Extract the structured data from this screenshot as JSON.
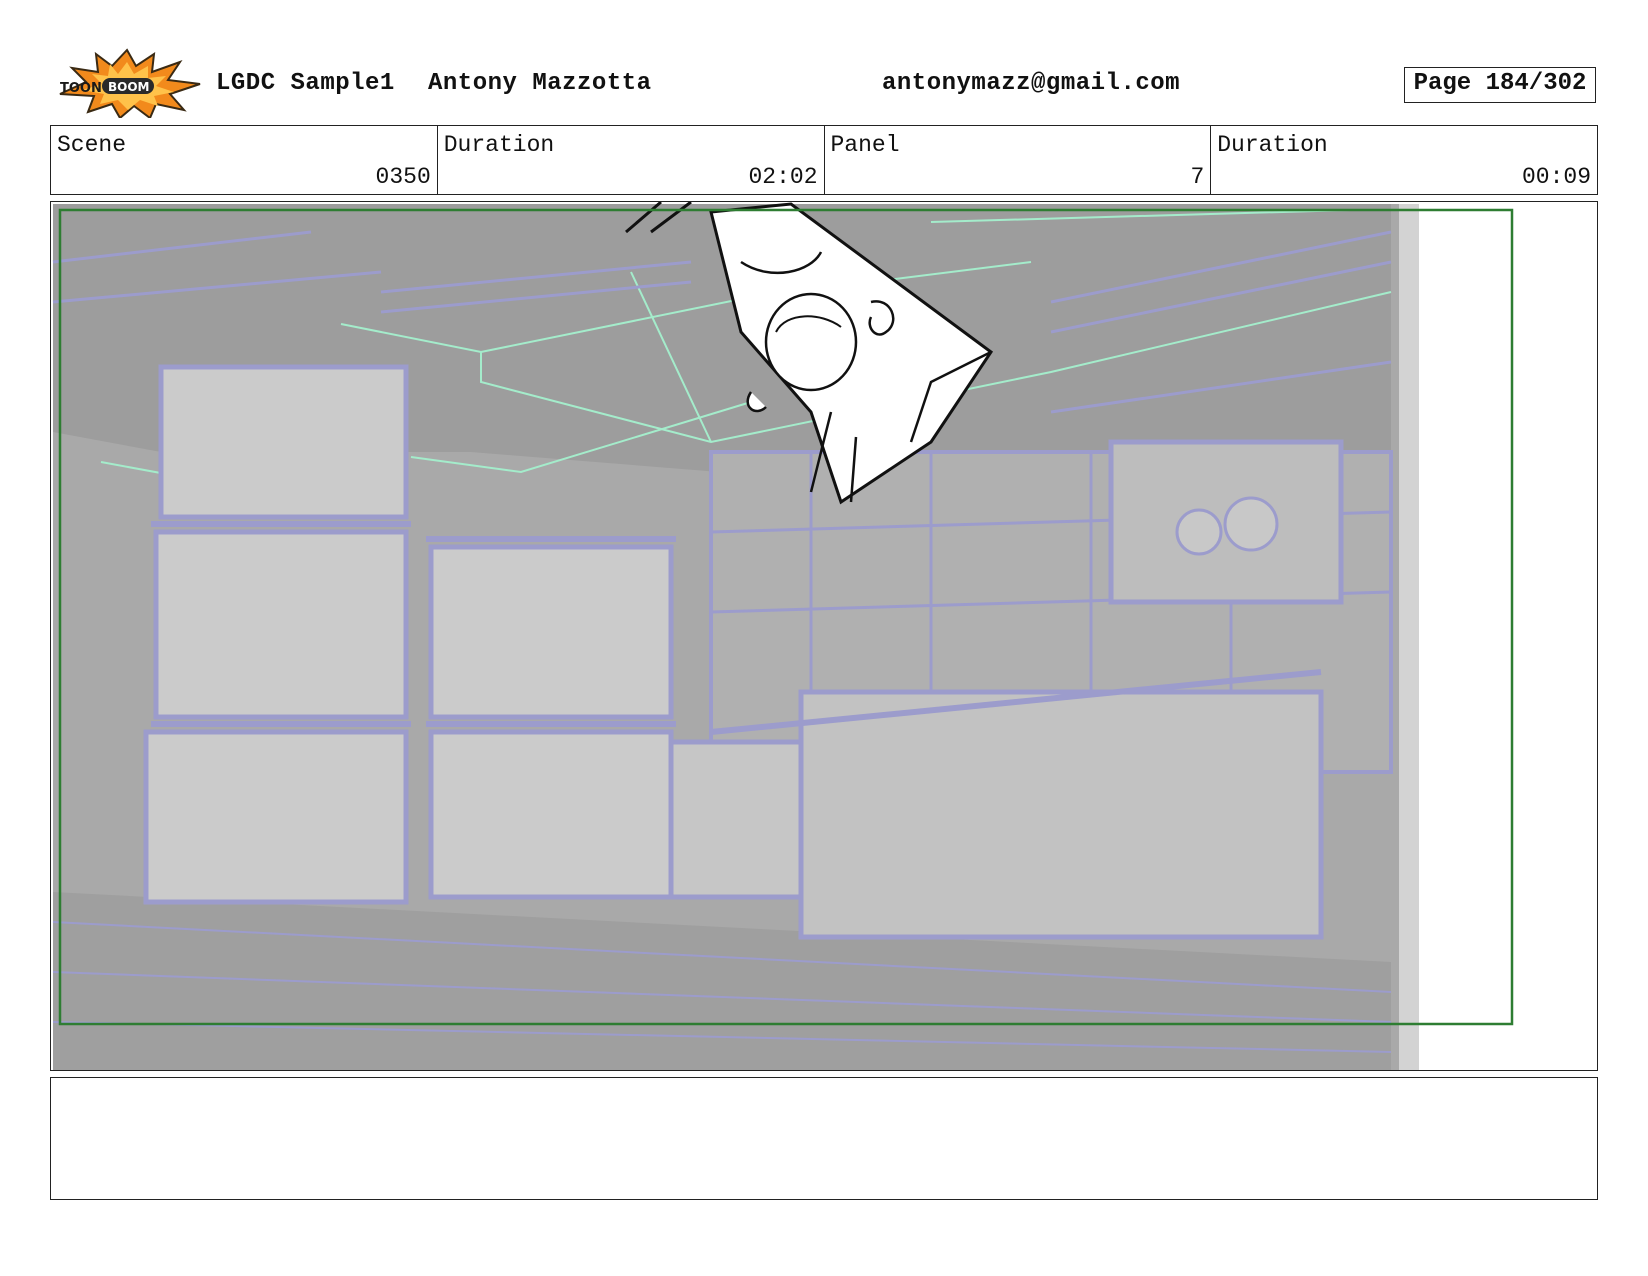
{
  "header": {
    "logo": {
      "icon": "toon-boom-logo",
      "text_left": "TOON",
      "text_right": "BOOM",
      "colors": {
        "burst": "#f28a1c",
        "outline": "#3a2a14"
      }
    },
    "project": "LGDC Sample1",
    "author": "Antony Mazzotta",
    "email": "antonymazz@gmail.com",
    "page": "Page 184/302"
  },
  "info": {
    "scene": {
      "label": "Scene",
      "value": "0350"
    },
    "scene_duration": {
      "label": "Duration",
      "value": "02:02"
    },
    "panel": {
      "label": "Panel",
      "value": "7"
    },
    "panel_duration": {
      "label": "Duration",
      "value": "00:09"
    }
  },
  "panel_image": {
    "description_icon": "storyboard-sketch",
    "colors": {
      "background": "#a8a8a8",
      "wireframe": "#9c9ccc",
      "ceiling_highlight": "#a4eccb",
      "safe_frame": "#2e7d32"
    }
  },
  "notes": {
    "text": ""
  }
}
